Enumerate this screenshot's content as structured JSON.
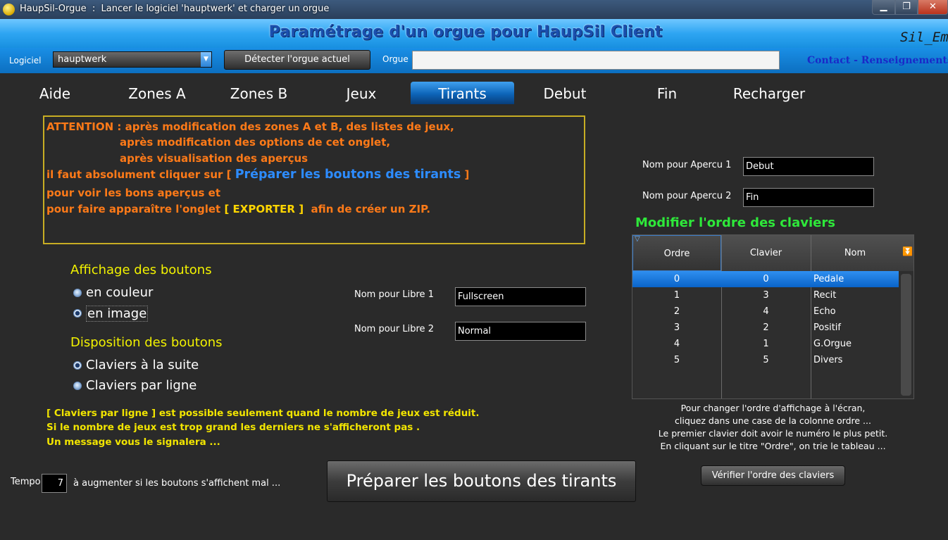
{
  "window": {
    "title": "HaupSil-Orgue  :  Lancer le logiciel 'hauptwerk' et charger un orgue",
    "min": "▁",
    "max": "❐",
    "close": "✕"
  },
  "header": {
    "title": "Paramétrage d'un orgue pour HaupSil Client",
    "user": "Sil_Em"
  },
  "toolbar": {
    "logiciel_label": "Logiciel",
    "logiciel_value": "hauptwerk",
    "detect_label": "Détecter l'orgue actuel",
    "orgue_label": "Orgue",
    "orgue_value": "",
    "contact_a": "Contact",
    "contact_sep": " - ",
    "contact_b": "Renseignements"
  },
  "tabs": [
    {
      "label": "Aide"
    },
    {
      "label": "Zones A"
    },
    {
      "label": "Zones B"
    },
    {
      "label": "Jeux"
    },
    {
      "label": "Tirants",
      "active": true
    },
    {
      "label": "Debut"
    },
    {
      "label": "Fin"
    },
    {
      "label": "Recharger"
    }
  ],
  "warning": {
    "l1": "ATTENTION : après modification des zones A et B, des listes de jeux,",
    "l2": "après modification des options de cet onglet,",
    "l3": "après visualisation des aperçus",
    "l4a": "il faut absolument cliquer sur [ ",
    "l4b": "Préparer les boutons des tirants",
    "l4c": " ]",
    "l5": "pour voir les bons aperçus et",
    "l6a": "pour faire apparaître l'onglet ",
    "l6b": "[ EXPORTER ]",
    "l6c": "  afin de créer un ZIP."
  },
  "affichage": {
    "title": "Affichage des boutons",
    "opt1": "en couleur",
    "opt2": "en image",
    "selected": "en image"
  },
  "disposition": {
    "title": "Disposition des boutons",
    "opt1": "Claviers à la suite",
    "opt2": "Claviers par ligne",
    "selected": "Claviers à la suite"
  },
  "notes": {
    "n1": "[ Claviers par ligne ] est possible seulement quand le nombre de jeux est réduit.",
    "n2": "Si le nombre de jeux est trop grand les derniers ne s'afficheront pas .",
    "n3": "Un message vous le signalera ..."
  },
  "libres": {
    "libre1_label": "Nom pour Libre 1",
    "libre1_value": "Fullscreen",
    "libre2_label": "Nom pour Libre 2",
    "libre2_value": "Normal"
  },
  "apercus": {
    "a1_label": "Nom pour Apercu 1",
    "a1_value": "Debut",
    "a2_label": "Nom pour Apercu 2",
    "a2_value": "Fin"
  },
  "claviers": {
    "title": "Modifier l'ordre des claviers",
    "columns": [
      "Ordre",
      "Clavier",
      "Nom"
    ],
    "rows": [
      {
        "ordre": "0",
        "clavier": "0",
        "nom": "Pedale"
      },
      {
        "ordre": "1",
        "clavier": "3",
        "nom": "Recit"
      },
      {
        "ordre": "2",
        "clavier": "4",
        "nom": "Echo"
      },
      {
        "ordre": "3",
        "clavier": "2",
        "nom": "Positif"
      },
      {
        "ordre": "4",
        "clavier": "1",
        "nom": "G.Orgue"
      },
      {
        "ordre": "5",
        "clavier": "5",
        "nom": "Divers"
      }
    ],
    "info1": "Pour changer l'ordre d'affichage à l'écran,",
    "info2": "cliquez dans une case de la colonne ordre ...",
    "info3": "Le premier clavier doit avoir le numéro le plus petit.",
    "info4": "En cliquant sur le titre \"Ordre\", on trie le tableau ...",
    "verify_label": "Vérifier l'ordre des claviers"
  },
  "tempo": {
    "label": "Tempo",
    "value": "7",
    "hint": "à augmenter si les boutons s'affichent mal ..."
  },
  "prepare_label": "Préparer les boutons des tirants",
  "colors": {
    "accent": "#1890e0",
    "warning_text": "#ff7a18",
    "section_title": "#f2f200",
    "claviers_title": "#2ee83a"
  }
}
